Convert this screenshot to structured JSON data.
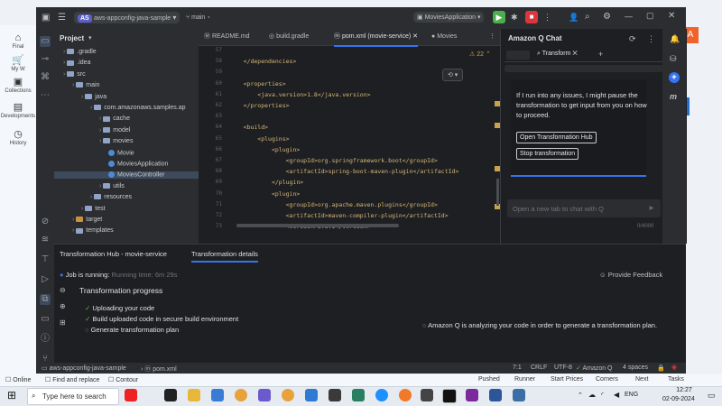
{
  "browser": {
    "side_items": [
      {
        "label": "Final",
        "icon": "home-icon"
      },
      {
        "label": "My W",
        "icon": "cart-icon"
      },
      {
        "label": "Collections",
        "icon": "collections-icon"
      },
      {
        "label": "Developments",
        "icon": "document-icon"
      },
      {
        "label": "History",
        "icon": "history-icon"
      }
    ],
    "badge_label": "A"
  },
  "ide": {
    "project_tag": "AS",
    "project_name": "aws-appconfig-java-sample",
    "branch": "main",
    "run_config": "MoviesApplication",
    "panel_title": "Project",
    "tabs": [
      "README.md",
      "build.gradle",
      "pom.xml (movie-service)",
      "Movies"
    ],
    "tree": [
      {
        "label": ".gradle",
        "indent": 1,
        "kind": "folder"
      },
      {
        "label": ".idea",
        "indent": 1,
        "kind": "folder"
      },
      {
        "label": "src",
        "indent": 1,
        "kind": "folder"
      },
      {
        "label": "main",
        "indent": 2,
        "kind": "folder"
      },
      {
        "label": "java",
        "indent": 3,
        "kind": "folder"
      },
      {
        "label": "com.amazonaws.samples.ap",
        "indent": 4,
        "kind": "folder"
      },
      {
        "label": "cache",
        "indent": 5,
        "kind": "folder"
      },
      {
        "label": "model",
        "indent": 5,
        "kind": "folder"
      },
      {
        "label": "movies",
        "indent": 5,
        "kind": "folder"
      },
      {
        "label": "Movie",
        "indent": 6,
        "kind": "class"
      },
      {
        "label": "MoviesApplication",
        "indent": 6,
        "kind": "class"
      },
      {
        "label": "MoviesController",
        "indent": 6,
        "kind": "class"
      },
      {
        "label": "utils",
        "indent": 5,
        "kind": "folder"
      },
      {
        "label": "resources",
        "indent": 4,
        "kind": "folder"
      },
      {
        "label": "test",
        "indent": 3,
        "kind": "folder"
      },
      {
        "label": "target",
        "indent": 2,
        "kind": "folder-orange"
      },
      {
        "label": "templates",
        "indent": 2,
        "kind": "folder"
      }
    ],
    "line_numbers": [
      "57",
      "58",
      "59",
      "60",
      "61",
      "62",
      "63",
      "64",
      "65",
      "66",
      "67",
      "68",
      "69",
      "70",
      "71",
      "72",
      "73"
    ],
    "code_lines": [
      "",
      "    </dependencies>",
      "",
      "    <properties>",
      "        <java.version>1.8</java.version>",
      "    </properties>",
      "",
      "    <build>",
      "        <plugins>",
      "            <plugin>",
      "                <groupId>org.springframework.boot</groupId>",
      "                <artifactId>spring-boot-maven-plugin</artifactId>",
      "            </plugin>",
      "            <plugin>",
      "                <groupId>org.apache.maven.plugins</groupId>",
      "                <artifactId>maven-compiler-plugin</artifactId>",
      "                <version>3.8.1</version>"
    ],
    "problems_count": "22",
    "q": {
      "title": "Amazon Q Chat",
      "tab_label": "Transform",
      "message": "If I run into any issues, I might pause the transformation to get input from you on how to proceed.",
      "btn_open": "Open Transformation Hub",
      "btn_stop": "Stop transformation",
      "input_placeholder": "Open a new tab to chat with Q",
      "char_count": "0/4000"
    },
    "bottom": {
      "tab_hub": "Transformation Hub - movie-service",
      "tab_details": "Transformation details",
      "job_status_label": "Job is running:",
      "job_status_value": "Running time: 6m 29s",
      "feedback": "Provide Feedback",
      "progress_title": "Transformation progress",
      "steps": [
        "Uploading your code",
        "Build uploaded code in secure build environment",
        "Generate transformation plan"
      ],
      "analyzing": "Amazon Q is analyzing your code in order to generate a transformation plan."
    },
    "status": {
      "project": "aws-appconfig-java-sample",
      "file": "pom.xml",
      "pos": "7:1",
      "eol": "CRLF",
      "enc": "UTF-8",
      "amazon_q": "Amazon Q",
      "indent": "4 spaces"
    }
  },
  "taskbar": {
    "search_placeholder": "Type here to search",
    "lang": "ENG",
    "time": "12:27",
    "date": "02-09-2024",
    "tray": [
      "Pushed",
      "Runner",
      "Start Prices",
      "Corners",
      "Next",
      "Tasks"
    ]
  }
}
